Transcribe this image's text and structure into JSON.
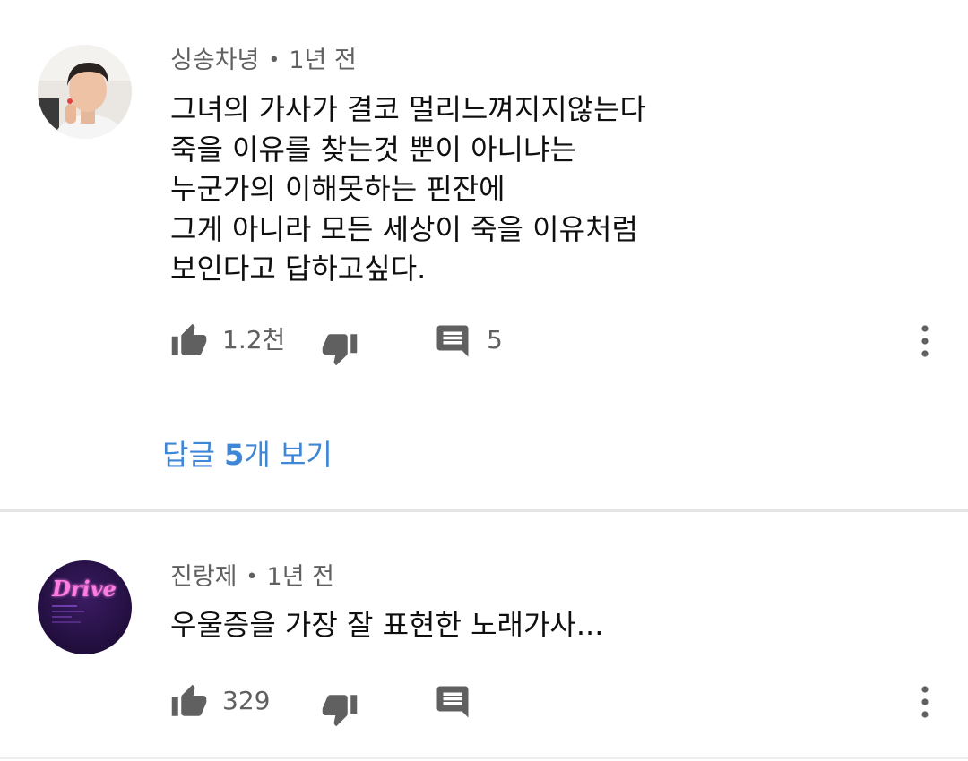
{
  "comments": [
    {
      "author": "싱송차녕",
      "time": "1년 전",
      "lines": [
        "그녀의 가사가 결코 멀리느껴지지않는다",
        "죽을 이유를 찾는것 뿐이 아니냐는",
        "누군가의 이해못하는 핀잔에",
        "그게 아니라 모든 세상이 죽을 이유처럼",
        "보인다고 답하고싶다."
      ],
      "likes": "1.2천",
      "reply_count": "5",
      "view_replies": {
        "prefix": "답글 ",
        "count": "5",
        "suffix": "개 보기"
      }
    },
    {
      "author": "진랑제",
      "time": "1년 전",
      "lines": [
        "우울증을 가장 잘 표현한 노래가사..."
      ],
      "likes": "329",
      "reply_count": ""
    }
  ],
  "avatar2_text": "Drive",
  "colors": {
    "link": "#3e86d6",
    "meta": "#606060",
    "icon": "#606060",
    "divider": "#e5e5e5",
    "avatar2_glow": "#ff4fd8"
  },
  "icons": {
    "like": "thumbs-up-icon",
    "dislike": "thumbs-down-icon",
    "reply": "comment-icon",
    "more": "more-vertical-icon"
  }
}
